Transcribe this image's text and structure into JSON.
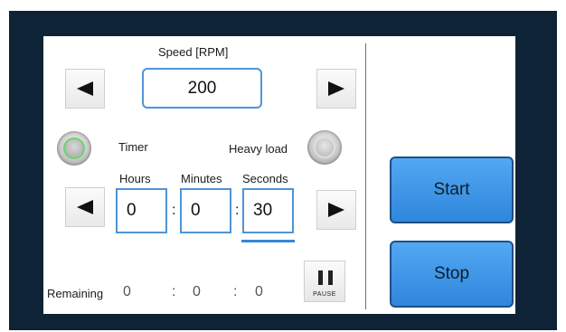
{
  "speed": {
    "label": "Speed [RPM]",
    "value": "200"
  },
  "indicators": {
    "timer_label": "Timer",
    "heavy_load_label": "Heavy load"
  },
  "timer": {
    "hours_label": "Hours",
    "minutes_label": "Minutes",
    "seconds_label": "Seconds",
    "hours_value": "0",
    "minutes_value": "0",
    "seconds_value": "30",
    "separator": ":"
  },
  "remaining": {
    "label": "Remaining",
    "hours": "0",
    "minutes": "0",
    "seconds": "0",
    "separator": ":"
  },
  "pause": {
    "label": "PAUSE"
  },
  "actions": {
    "start_label": "Start",
    "stop_label": "Stop"
  },
  "icons": {
    "speed_decrease": "left-arrow-icon",
    "speed_increase": "right-arrow-icon",
    "time_decrease": "left-arrow-icon",
    "time_increase": "right-arrow-icon",
    "pause": "pause-icon"
  },
  "colors": {
    "frame": "#0f2336",
    "field_border": "#4f94d6",
    "selected_underline": "#3a86d6",
    "button_fill": "#3d96e6",
    "timer_led_ring": "#6fd36f"
  }
}
